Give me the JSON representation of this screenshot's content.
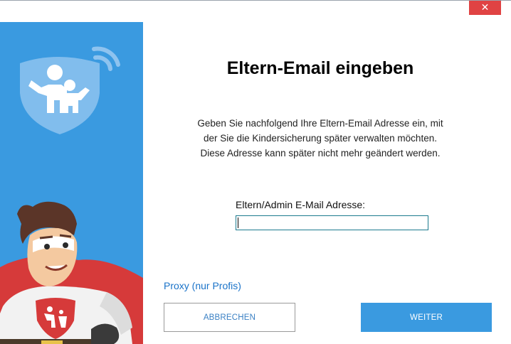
{
  "window": {
    "close_icon": "close-icon",
    "close_symbol": "✕",
    "colors": {
      "sidebar": "#3a9ae0",
      "close": "#e04343",
      "primary_button": "#3a9ae0",
      "link": "#1a73c9"
    }
  },
  "sidebar": {
    "logo_icon": "shield-family-wifi-icon",
    "mascot": "superhero-mascot"
  },
  "main": {
    "title": "Eltern-Email eingeben",
    "description_lines": [
      "Geben Sie nachfolgend Ihre Eltern-Email Adresse ein, mit",
      "der Sie die Kindersicherung später verwalten möchten.",
      "Diese Adresse kann später nicht mehr geändert werden."
    ],
    "email_label": "Eltern/Admin E-Mail Adresse:",
    "email_value": "",
    "proxy_link": "Proxy (nur Profis)",
    "cancel_label": "ABBRECHEN",
    "next_label": "WEITER"
  }
}
